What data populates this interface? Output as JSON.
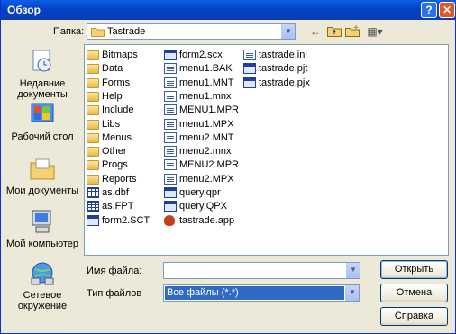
{
  "window": {
    "title": "Обзор",
    "help_glyph": "?",
    "close_glyph": "✕"
  },
  "lookin": {
    "label": "Папка:",
    "value": "Tastrade"
  },
  "toolbar": {
    "back_glyph": "←",
    "up_glyph": "⇧",
    "newfolder_glyph": "✱",
    "views_glyph": "▦▾"
  },
  "places": [
    {
      "name": "recent",
      "icon": "recent-documents-icon",
      "label": "Недавние документы"
    },
    {
      "name": "desktop",
      "icon": "desktop-icon",
      "label": "Рабочий стол"
    },
    {
      "name": "mydocs",
      "icon": "my-documents-icon",
      "label": "Мои документы"
    },
    {
      "name": "mycomputer",
      "icon": "my-computer-icon",
      "label": "Мой компьютер"
    },
    {
      "name": "network",
      "icon": "network-places-icon",
      "label": "Сетевое окружение"
    }
  ],
  "files": {
    "col1": [
      {
        "name": "Bitmaps",
        "type": "folder"
      },
      {
        "name": "Data",
        "type": "folder"
      },
      {
        "name": "Forms",
        "type": "folder"
      },
      {
        "name": "Help",
        "type": "folder"
      },
      {
        "name": "Include",
        "type": "folder"
      },
      {
        "name": "Libs",
        "type": "folder"
      },
      {
        "name": "Menus",
        "type": "folder"
      },
      {
        "name": "Other",
        "type": "folder"
      },
      {
        "name": "Progs",
        "type": "folder"
      },
      {
        "name": "Reports",
        "type": "folder"
      },
      {
        "name": "as.dbf",
        "type": "table"
      },
      {
        "name": "as.FPT",
        "type": "table"
      },
      {
        "name": "form2.SCT",
        "type": "form"
      }
    ],
    "col2": [
      {
        "name": "form2.scx",
        "type": "form"
      },
      {
        "name": "menu1.BAK",
        "type": "doc"
      },
      {
        "name": "menu1.MNT",
        "type": "doc"
      },
      {
        "name": "menu1.mnx",
        "type": "doc"
      },
      {
        "name": "MENU1.MPR",
        "type": "doc"
      },
      {
        "name": "menu1.MPX",
        "type": "doc"
      },
      {
        "name": "menu2.MNT",
        "type": "doc"
      },
      {
        "name": "menu2.mnx",
        "type": "doc"
      },
      {
        "name": "MENU2.MPR",
        "type": "doc"
      },
      {
        "name": "menu2.MPX",
        "type": "doc"
      },
      {
        "name": "query.qpr",
        "type": "form"
      },
      {
        "name": "query.QPX",
        "type": "form"
      },
      {
        "name": "tastrade.app",
        "type": "fox"
      }
    ],
    "col3": [
      {
        "name": "tastrade.ini",
        "type": "doc"
      },
      {
        "name": "tastrade.pjt",
        "type": "form"
      },
      {
        "name": "tastrade.pjx",
        "type": "form"
      }
    ]
  },
  "filename": {
    "label": "Имя файла:",
    "value": ""
  },
  "filetype": {
    "label": "Тип файлов",
    "value": "Все файлы (*.*)"
  },
  "buttons": {
    "open": "Открыть",
    "cancel": "Отмена",
    "help": "Справка"
  },
  "colors": {
    "title_bar": "#0442c7",
    "selection": "#316ac5",
    "face": "#ece9d8"
  }
}
